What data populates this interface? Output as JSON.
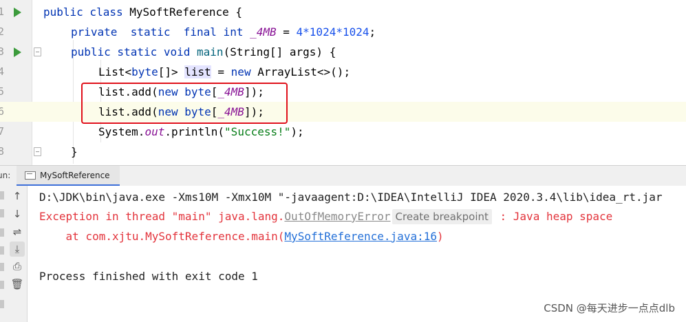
{
  "editor": {
    "line_numbers": [
      "1",
      "2",
      "3",
      "4",
      "5",
      "6",
      "7",
      "8"
    ],
    "code": {
      "l1_kw": "public class",
      "l1_rest": " MySoftReference {",
      "l2_kw": "private  static  final int",
      "l2_const": "_4MB",
      "l2_eq": " = ",
      "l2_num": "4*1024*1024",
      "l2_end": ";",
      "l3_kw": "public static void",
      "l3_method": "main",
      "l3_rest": "(String[] args) {",
      "l4_type": "List<",
      "l4_kw": "byte",
      "l4_type2": "[]> ",
      "l4_var": "list",
      "l4_eq": " = ",
      "l4_new": "new",
      "l4_rest": " ArrayList<>();",
      "l5_a": "list.add(",
      "l5_new": "new byte",
      "l5_b": "[",
      "l5_const": "_4MB",
      "l5_c": "]);",
      "l6_a": "list.add(",
      "l6_new": "new byte",
      "l6_b": "[",
      "l6_const": "_4MB",
      "l6_c": "]);",
      "l7_a": "System.",
      "l7_out": "out",
      "l7_b": ".println(",
      "l7_str": "\"Success!\"",
      "l7_c": ");",
      "l8": "}"
    }
  },
  "run_window": {
    "label": "un:",
    "tab_label": "MySoftReference"
  },
  "console": {
    "line1": "D:\\JDK\\bin\\java.exe -Xms10M -Xmx10M \"-javaagent:D:\\IDEA\\IntelliJ IDEA 2020.3.4\\lib\\idea_rt.jar",
    "line2_prefix": "Exception in thread \"main\" java.lang.",
    "line2_link": "OutOfMemoryError",
    "tooltip": "Create breakpoint",
    "line2_suffix": " : Java heap space",
    "line3_prefix": "    at com.xjtu.MySoftReference.main(",
    "line3_link": "MySoftReference.java:16",
    "line3_suffix": ")",
    "line5": "Process finished with exit code 1"
  },
  "watermark": "CSDN @每天进步一点点dlb",
  "colors": {
    "keyword": "#0033b3",
    "error": "#e3343c",
    "link": "#2470d8",
    "annotation_box": "#e0101a"
  }
}
